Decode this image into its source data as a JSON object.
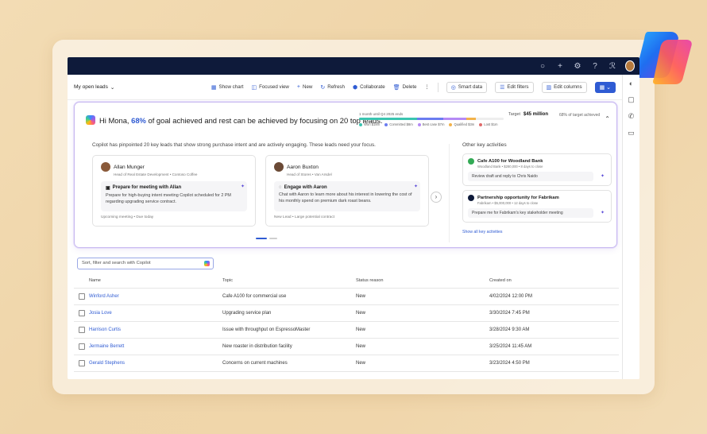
{
  "command_bar": {
    "view": "My open leads",
    "buttons": [
      "Show chart",
      "Focused view",
      "New",
      "Refresh",
      "Collaborate",
      "Delete",
      "Smart data",
      "Edit filters",
      "Edit columns"
    ]
  },
  "copilot": {
    "greeting_pre": "Hi Mona, ",
    "greeting_pct": "68%",
    "greeting_post": " of goal achieved and rest can be achieved by focusing on 20 top leads.",
    "progress_caption": "1 month until Q4 2025 ends",
    "legend": [
      "Won $18m",
      "Committed $8m",
      "Best case $7m",
      "Qualified $3m",
      "Lost $1m"
    ],
    "target_label": "Target",
    "target_value": "$45 million",
    "target_pct": "68% of target achieved",
    "description": "Copilot has pinpointed 20 key leads that show strong purchase intent and are actively engaging. These leads need your focus.",
    "leads": [
      {
        "name": "Allan Munger",
        "role": "Head of Real Estate Development • Contoso Coffee",
        "action": "Prepare for meeting with Allan",
        "detail": "Prepare for high-buying intent meeting Copilot scheduled for 2 PM regarding upgrading service contract.",
        "footer": "Upcoming meeting • Due today"
      },
      {
        "name": "Aaron Buxton",
        "role": "Head of Stores • Van Arsdel",
        "action": "Engage with Aaron",
        "detail": "Chat with Aaron to learn more about his interest in lowering the cost of his monthly spend on premium dark roast beans.",
        "footer": "New Lead • Large potential contract"
      }
    ],
    "other_heading": "Other key activities",
    "activities": [
      {
        "title": "Cafe A100 for Woodland Bank",
        "sub": "Woodland Bank • $280,000 • 8 days to close",
        "action": "Review draft and reply to Chris Naido"
      },
      {
        "title": "Partnership opportunity for Fabrikam",
        "sub": "Fabrikam • $5,000,000 • 12 days to close",
        "action": "Prepare me for Fabrikam's key stakeholder meeting"
      }
    ],
    "show_all": "Show all key activities"
  },
  "search": {
    "placeholder": "Sort, filter and search with Copilot"
  },
  "table": {
    "headers": [
      "Name",
      "Topic",
      "Status reason",
      "Created on"
    ],
    "rows": [
      [
        "Winford Asher",
        "Cafe A100 for commercial use",
        "New",
        "4/02/2024 12:00 PM"
      ],
      [
        "Josia Love",
        "Upgrading service plan",
        "New",
        "3/30/2024 7:45 PM"
      ],
      [
        "Harrison Curtis",
        "Issue with throughput on EspressoMaster",
        "New",
        "3/28/2024 9:30 AM"
      ],
      [
        "Jermaine Berrett",
        "New roaster in distribution facility",
        "New",
        "3/25/2024 11:45 AM"
      ],
      [
        "Gerald Stephens",
        "Concerns on current machines",
        "New",
        "3/23/2024 4:50 PM"
      ]
    ]
  },
  "colors": {
    "accent": "#2f5bd3",
    "topbar": "#0e1a3a"
  }
}
